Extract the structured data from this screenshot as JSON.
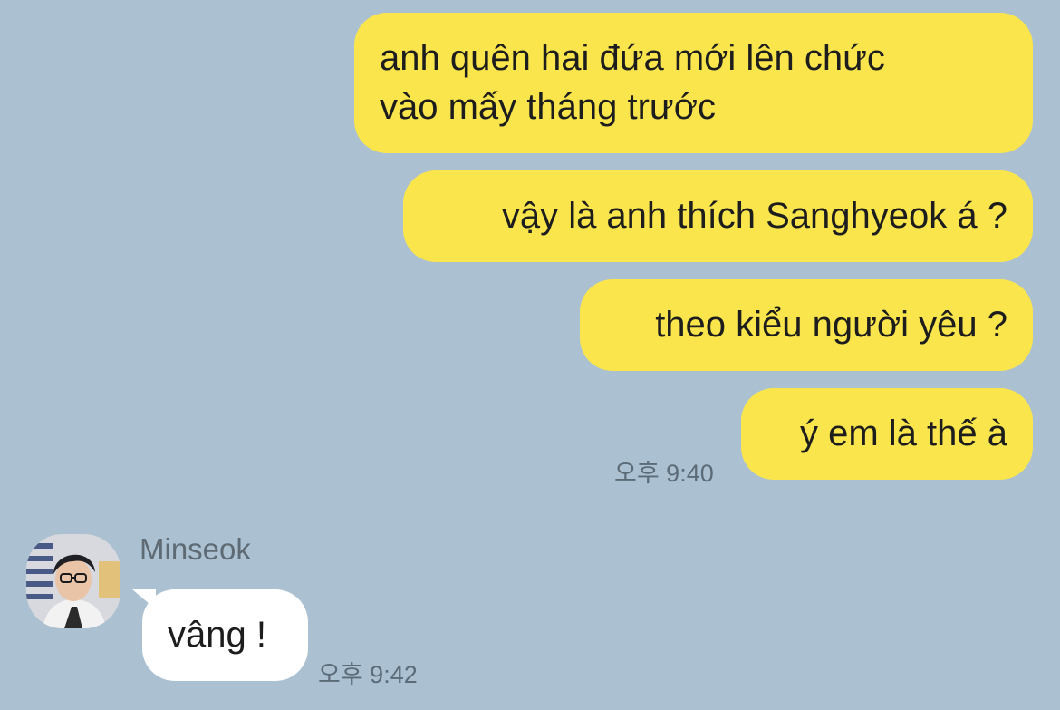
{
  "chat": {
    "messages": [
      {
        "text": "anh quên hai đứa mới lên chức\nvào mấy tháng trước",
        "direction": "outgoing"
      },
      {
        "text": "vậy là anh thích Sanghyeok á ?",
        "direction": "outgoing"
      },
      {
        "text": "theo kiểu người yêu ?",
        "direction": "outgoing"
      },
      {
        "text": "ý em là thế à",
        "direction": "outgoing",
        "time": "오후 9:40"
      },
      {
        "text": "vâng !",
        "direction": "incoming",
        "sender": "Minseok",
        "time": "오후 9:42"
      }
    ]
  },
  "colors": {
    "background": "#abc1d1",
    "outgoing_bubble": "#fae64c",
    "incoming_bubble": "#ffffff"
  }
}
